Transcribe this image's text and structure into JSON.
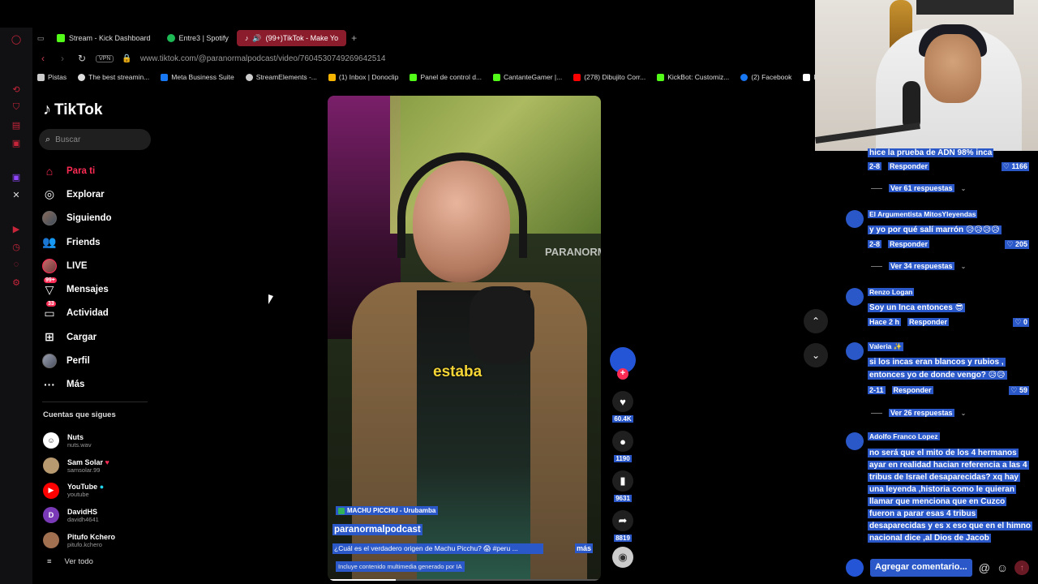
{
  "browser": {
    "tabs": [
      {
        "label": "Stream - Kick Dashboard",
        "icon": "kick-icon",
        "color": "#53fc18",
        "active": false
      },
      {
        "label": "Entre3 | Spotify",
        "icon": "spotify-icon",
        "color": "#1db954",
        "active": false
      },
      {
        "label": "(99+)TikTok - Make Yo",
        "icon": "tiktok-icon",
        "color": "#ffffff",
        "active": true
      }
    ],
    "new_tab_label": "+",
    "url": "www.tiktok.com/@paranormalpodcast/video/7604530749269642514",
    "vpn_label": "VPN",
    "bookmarks": [
      {
        "label": "Pistas",
        "color": "#cccccc"
      },
      {
        "label": "The best streamin...",
        "color": "#dddddd"
      },
      {
        "label": "Meta Business Suite",
        "color": "#1877f2"
      },
      {
        "label": "StreamElements -...",
        "color": "#cccccc"
      },
      {
        "label": "(1) Inbox | Donoclip",
        "color": "#f4b400"
      },
      {
        "label": "Panel de control d...",
        "color": "#53fc18"
      },
      {
        "label": "CantanteGamer |...",
        "color": "#53fc18"
      },
      {
        "label": "(278) Dibujito Corr...",
        "color": "#ff0000"
      },
      {
        "label": "KickBot: Customiz...",
        "color": "#53fc18"
      },
      {
        "label": "(2) Facebook",
        "color": "#1877f2"
      },
      {
        "label": "Fr",
        "color": "#ffffff"
      }
    ]
  },
  "tiktok": {
    "logo": "TikTok",
    "search_placeholder": "Buscar",
    "nav": [
      {
        "label": "Para ti",
        "icon": "home-icon",
        "active": true
      },
      {
        "label": "Explorar",
        "icon": "compass-icon"
      },
      {
        "label": "Siguiendo",
        "icon": "following-avatar-icon"
      },
      {
        "label": "Friends",
        "icon": "friends-icon"
      },
      {
        "label": "LIVE",
        "icon": "live-avatar-icon"
      },
      {
        "label": "Mensajes",
        "icon": "messages-icon",
        "badge": "99+"
      },
      {
        "label": "Actividad",
        "icon": "activity-icon",
        "badge": "33"
      },
      {
        "label": "Cargar",
        "icon": "upload-icon"
      },
      {
        "label": "Perfil",
        "icon": "profile-avatar-icon"
      },
      {
        "label": "Más",
        "icon": "more-icon"
      }
    ],
    "following_title": "Cuentas que sigues",
    "following": [
      {
        "name": "Nuts",
        "handle": "nuts.wav",
        "color": "#ffffff"
      },
      {
        "name": "Sam Solar",
        "handle": "samsolar.99",
        "color": "#b89a70"
      },
      {
        "name": "YouTube",
        "handle": "youtube",
        "color": "#ff0000"
      },
      {
        "name": "DavidHS",
        "handle": "davidh4641",
        "color": "#7a3ab8",
        "initial": "D"
      },
      {
        "name": "Pitufo Kchero",
        "handle": "pitufo.kchero",
        "color": "#a07050"
      }
    ],
    "see_all": "Ver todo"
  },
  "video": {
    "caption_word": "estaba",
    "watermark": "PARANORMAL",
    "location": "MACHU PICCHU - Urubamba",
    "author": "paranormalpodcast",
    "description": "¿Cuál es el verdadero origen de Machu Picchu? 😱 #peru ...",
    "more": "más",
    "ai_label": "Incluye contenido multimedia generado por IA",
    "progress": 0.25,
    "likes": "60.4K",
    "comments": "1190",
    "saves": "9631",
    "shares": "8819"
  },
  "comments": [
    {
      "text": "hice la prueba de ADN 98% inca",
      "date": "2-8",
      "reply": "Responder",
      "likes": "1166",
      "replies": "Ver 61 respuestas"
    },
    {
      "name": "El Argumentista MitosYleyendas",
      "text": "y yo por qué salí marrón 😥😥😥😥",
      "date": "2-8",
      "reply": "Responder",
      "likes": "205",
      "replies": "Ver 34 respuestas"
    },
    {
      "name": "Renzo Logan",
      "text": "Soy un Inca entonces 😎",
      "date": "Hace 2 h",
      "reply": "Responder",
      "likes": "0"
    },
    {
      "name": "Valeria ✨",
      "text1": "si los incas eran blancos y rubios ,",
      "text2": "entonces yo de donde vengo? 😥😥",
      "date": "2-11",
      "reply": "Responder",
      "likes": "59",
      "replies": "Ver 26 respuestas"
    },
    {
      "name": "Adolfo Franco Lopez",
      "lines": [
        "no será que el mito de los 4 hermanos",
        "ayar en realidad hacian referencia a las 4",
        "tribus de Israel desaparecidas? xq hay",
        "una leyenda ,historia como le quieran",
        "llamar que menciona que en Cuzco",
        "fueron a parar esas 4 tribus",
        "desaparecidas y es x eso que en el himno",
        "nacional dice ,al Dios de Jacob"
      ]
    }
  ],
  "composer_placeholder": "Agregar comentario..."
}
